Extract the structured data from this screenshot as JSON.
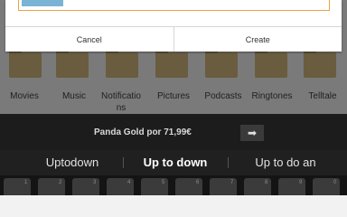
{
  "dialog": {
    "cancel_label": "Cancel",
    "create_label": "Create"
  },
  "folders": [
    {
      "label": "Movies"
    },
    {
      "label": "Music"
    },
    {
      "label": "Notifications"
    },
    {
      "label": "Pictures"
    },
    {
      "label": "Podcasts"
    },
    {
      "label": "Ringtones"
    },
    {
      "label": "Telltale"
    }
  ],
  "ad": {
    "text": "Panda Gold por 71,99€",
    "arrow": "➡"
  },
  "suggestions": [
    {
      "text": "Uptodown"
    },
    {
      "text": "Up to down"
    },
    {
      "text": "Up to do an"
    }
  ],
  "keyboard": {
    "hints": [
      "1",
      "2",
      "3",
      "4",
      "5",
      "6",
      "7",
      "8",
      "9",
      "0"
    ]
  },
  "colors": {
    "dialog_bg": "#ffffff",
    "input_accent": "#e8a24a",
    "selection": "#7ab3d4",
    "keyboard_bg": "#141414",
    "ad_bg": "#1c1c1c"
  }
}
